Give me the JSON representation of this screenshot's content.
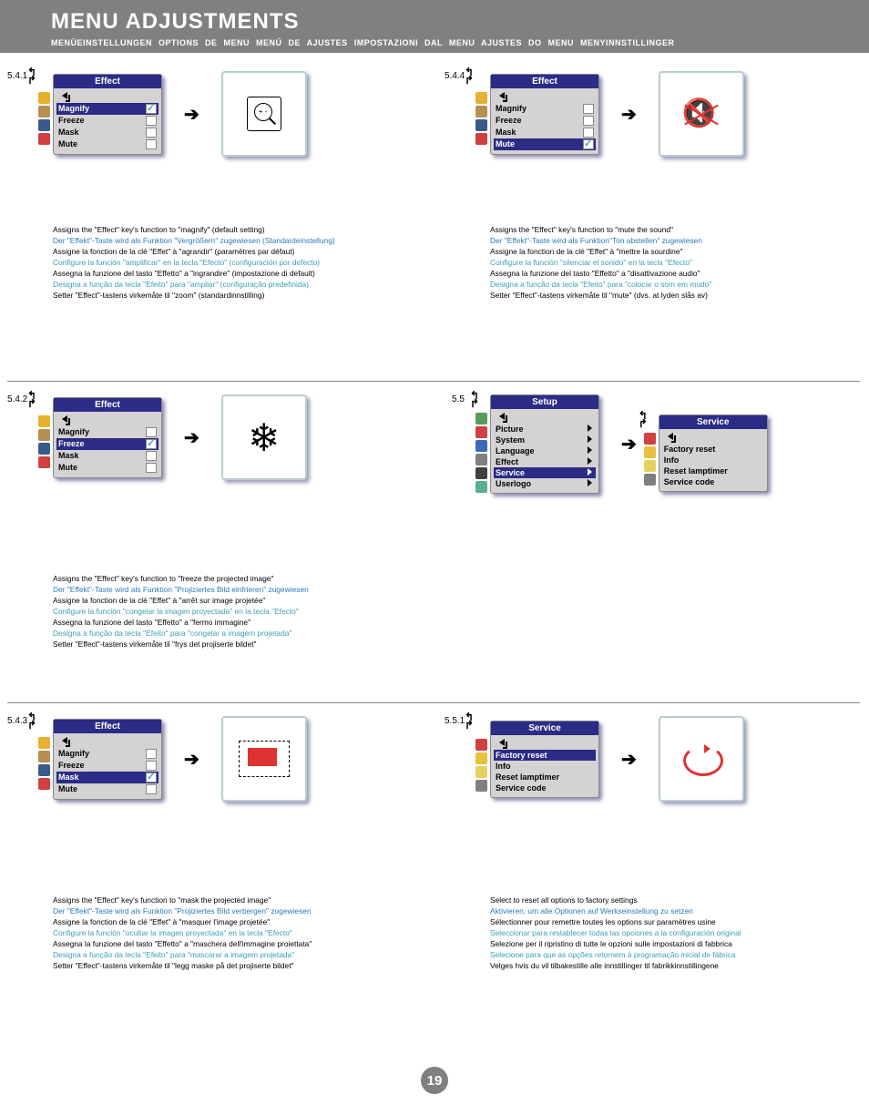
{
  "header": {
    "title": "MENU ADJUSTMENTS",
    "subtitles": "MENÜEINSTELLUNGEN   OPTIONS DE MENU   MENÚ DE AJUSTES   IMPOSTAZIONI DAL MENU   AJUSTES DO MENU   MENYINNSTILLINGER"
  },
  "page_number": "19",
  "sections": {
    "s541": {
      "num": "5.4.1",
      "menu_title": "Effect",
      "items": {
        "magnify": "Magnify",
        "freeze": "Freeze",
        "mask": "Mask",
        "mute": "Mute"
      },
      "desc": {
        "en": "Assigns the \"Effect\" key's function to \"magnify\" (default setting)",
        "de": "Der \"Effekt\"-Taste wird als Funktion \"Vergrößern\" zugewiesen (Standardeinstellung)",
        "fr": "Assigne la fonction de la clé \"Effet\" à \"agrandir\" (paramètres par défaut)",
        "es": "Configure la función \"amplificar\" en la tecla \"Efecto\" (configuración por defecto)",
        "it": "Assegna la funzione del tasto \"Effetto\" a \"ingrandire\" (impostazione di default)",
        "pt": "Designa a função da tecla \"Efeito\" para \"ampliar\" (configuração predefinida)",
        "no": "Setter \"Effect\"-tastens virkemåte til \"zoom\" (standardinnstilling)"
      }
    },
    "s542": {
      "num": "5.4.2",
      "menu_title": "Effect",
      "desc": {
        "en": "Assigns the \"Effect\" key's function to \"freeze the projected image\"",
        "de": "Der \"Effekt\"-Taste wird als Funktion \"Projiziertes Bild einfrieren\" zugewiesen",
        "fr": "Assigne la fonction de la clé \"Effet\" à \"arrêt sur image projetée\"",
        "es": "Configure la función \"congelar la imagen proyectada\" en la tecla \"Efecto\"",
        "it": "Assegna la funzione del tasto \"Effetto\" a \"fermo immagine\"",
        "pt": "Designa a função da tecla \"Efeito\" para \"congelar a imagem projetada\"",
        "no": "Setter \"Effect\"-tastens virkemåte til \"frys det projiserte bildet\""
      }
    },
    "s543": {
      "num": "5.4.3",
      "menu_title": "Effect",
      "desc": {
        "en": "Assigns the \"Effect\" key's function to \"mask the projected image\"",
        "de": "Der \"Effekt\"-Taste wird als Funktion \"Projiziertes Bild verbergen\" zugewiesen",
        "fr": "Assigne la fonction de la clé \"Effet\" à \"masquer l'image projetée\"",
        "es": "Configure la función \"ocultar la imagen proyectada\" en la tecla \"Efecto\"",
        "it": "Assegna la funzione del tasto \"Effetto\" a \"maschera dell'immagine proiettata\"",
        "pt": "Designa a função da tecla \"Efeito\" para \"mascarar a imagem projetada\"",
        "no": "Setter \"Effect\"-tastens virkemåte til \"legg maske på det projiserte bildet\""
      }
    },
    "s544": {
      "num": "5.4.4",
      "menu_title": "Effect",
      "desc": {
        "en": "Assigns the \"Effect\" key's function to \"mute the sound\"",
        "de": "Der \"Effekt\"-Taste wird als Funktion\"Ton abstellen\" zugewiesen",
        "fr": "Assigne la fonction de la clé \"Effet\" à \"mettre la sourdine\"",
        "es": "Configure la función \"silenciar el sonido\" en la tecla \"Efecto\"",
        "it": "Assegna la funzione del tasto \"Effetto\" a \"disattivazione audio\"",
        "pt": "Designa a função da tecla \"Efeito\" para \"colocar o som em mudo\"",
        "no": "Setter \"Effect\"-tastens virkemåte til \"mute\" (dvs. at lyden slås av)"
      }
    },
    "s55": {
      "num": "5.5",
      "menu_title": "Setup",
      "items": {
        "picture": "Picture",
        "system": "System",
        "language": "Language",
        "effect": "Effect",
        "service": "Service",
        "userlogo": "Userlogo"
      },
      "service_title": "Service",
      "service_items": {
        "reset": "Factory reset",
        "info": "Info",
        "lamp": "Reset lamptimer",
        "code": "Service code"
      }
    },
    "s551": {
      "num": "5.5.1",
      "menu_title": "Service",
      "items": {
        "reset": "Factory reset",
        "info": "Info",
        "lamp": "Reset lamptimer",
        "code": "Service code"
      },
      "desc": {
        "en": "Select to reset all options to factory settings",
        "de": "Aktivieren, um alle Optionen auf Werkseinstellung zu setzen",
        "fr": "Sélectionner pour remettre toutes les options sur paramètres usine",
        "es": "Seleccionar para restablecer todas las opciones a la configuración original",
        "it": "Selezione per il ripristino di tutte le opzioni sulle impostazioni di fabbrica",
        "pt": "Selecione para que as opções retornem à programação inicial de fábrica",
        "no": "Velges hvis du vil tilbakestille alle innstillinger til fabrikkinnstillingene"
      }
    }
  }
}
